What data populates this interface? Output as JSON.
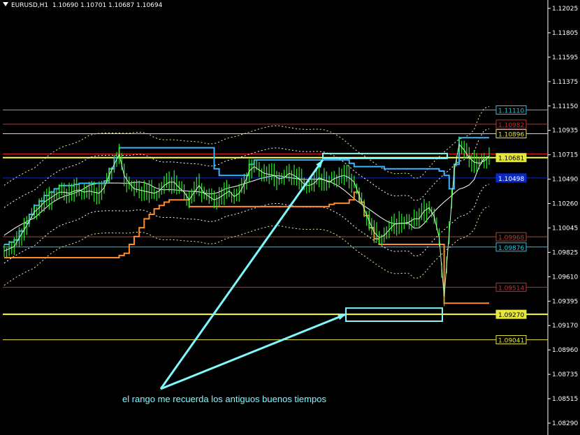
{
  "header": {
    "symbol": "EURUSD,H1",
    "open": "1.10690",
    "high": "1.10701",
    "low": "1.10687",
    "close": "1.10694"
  },
  "caption": "el rango me recuerda los antiguos buenos tiempos",
  "chart_data": {
    "type": "line",
    "symbol": "EURUSD",
    "timeframe": "H1",
    "ylim": [
      1.0841,
      1.1232
    ],
    "y_ticks": [
      "1.12025",
      "1.11805",
      "1.11595",
      "1.11375",
      "1.11150",
      "1.10935",
      "1.10715",
      "1.10490",
      "1.10260",
      "1.10045",
      "1.09825",
      "1.09610",
      "1.09395",
      "1.09170",
      "1.08960",
      "1.08735",
      "1.08515",
      "1.08290"
    ],
    "axis_labels": [
      {
        "value": "1.11110",
        "price": 1.1111,
        "bg": "#000000",
        "border": "#1ec8e6",
        "text": "#1ec8e6"
      },
      {
        "value": "1.10982",
        "price": 1.10982,
        "bg": "#000000",
        "border": "#c03030",
        "text": "#c03030"
      },
      {
        "value": "1.10896",
        "price": 1.10896,
        "bg": "#000000",
        "border": "#e6e640",
        "text": "#e6e640"
      },
      {
        "value": "1.10681",
        "price": 1.10681,
        "bg": "#e6e640",
        "border": "#e6e640",
        "text": "#000000"
      },
      {
        "value": "1.10498",
        "price": 1.10498,
        "bg": "#0a28c8",
        "border": "#0a28c8",
        "text": "#ffffff"
      },
      {
        "value": "1.09968",
        "price": 1.09968,
        "bg": "#000000",
        "border": "#a84a38",
        "text": "#a84a38"
      },
      {
        "value": "1.09876",
        "price": 1.09876,
        "bg": "#000000",
        "border": "#1ec8e6",
        "text": "#1ec8e6"
      },
      {
        "value": "1.09514",
        "price": 1.09514,
        "bg": "#000000",
        "border": "#c03030",
        "text": "#c03030"
      },
      {
        "value": "1.09270",
        "price": 1.0927,
        "bg": "#e6e640",
        "border": "#e6e640",
        "text": "#000000"
      },
      {
        "value": "1.09041",
        "price": 1.09041,
        "bg": "#000000",
        "border": "#e6e640",
        "text": "#e6e640"
      }
    ],
    "hlines": [
      {
        "price": 1.1111,
        "color": "#1ec8e6",
        "width": 1
      },
      {
        "price": 1.10982,
        "color": "#c03030",
        "width": 1
      },
      {
        "price": 1.10896,
        "color": "#e6e640",
        "width": 1
      },
      {
        "price": 1.10715,
        "color": "#ff2020",
        "width": 1
      },
      {
        "price": 1.10681,
        "color": "#ffff40",
        "width": 2
      },
      {
        "price": 1.10498,
        "color": "#0a28c8",
        "width": 1
      },
      {
        "price": 1.09968,
        "color": "#a84a38",
        "width": 1
      },
      {
        "price": 1.09876,
        "color": "#1ec8e6",
        "width": 1
      },
      {
        "price": 1.09514,
        "color": "#c03030",
        "width": 1
      },
      {
        "price": 1.0927,
        "color": "#ffff40",
        "width": 2
      },
      {
        "price": 1.09041,
        "color": "#e6e640",
        "width": 1
      }
    ],
    "price_series": [
      1.0984,
      1.0986,
      1.0988,
      1.0996,
      1.1003,
      1.1011,
      1.1019,
      1.1023,
      1.1028,
      1.1031,
      1.1034,
      1.1037,
      1.1037,
      1.1036,
      1.1038,
      1.1039,
      1.1037,
      1.1038,
      1.1037,
      1.1036,
      1.1041,
      1.1052,
      1.1062,
      1.1071,
      1.1052,
      1.1045,
      1.104,
      1.1039,
      1.1038,
      1.1037,
      1.1036,
      1.1038,
      1.1043,
      1.1046,
      1.1046,
      1.1041,
      1.1037,
      1.103,
      1.1037,
      1.1043,
      1.1036,
      1.1033,
      1.103,
      1.1032,
      1.1035,
      1.1038,
      1.1033,
      1.1036,
      1.1044,
      1.1056,
      1.106,
      1.1057,
      1.1054,
      1.1053,
      1.1052,
      1.1049,
      1.105,
      1.1054,
      1.1052,
      1.1049,
      1.1044,
      1.1043,
      1.1045,
      1.105,
      1.1048,
      1.1046,
      1.1049,
      1.1051,
      1.1052,
      1.105,
      1.1046,
      1.1034,
      1.1022,
      1.1011,
      1.1001,
      1.0996,
      1.0998,
      1.1003,
      1.1008,
      1.1009,
      1.1009,
      1.101,
      1.1013,
      1.1013,
      1.102,
      1.1023,
      1.1015,
      1.0996,
      1.0943,
      1.1,
      1.1056,
      1.108,
      1.1075,
      1.1068,
      1.1064,
      1.1063,
      1.1065,
      1.1069
    ],
    "dotted_pairs_note": "",
    "annotations": [
      {
        "type": "rectangle",
        "price_top": 1.10718,
        "price_bottom": 1.10674,
        "color": "#7ff8ff"
      },
      {
        "type": "rectangle",
        "price_top": 1.09326,
        "price_bottom": 1.09208,
        "color": "#7ff8ff"
      },
      {
        "type": "text",
        "text_ref": "caption",
        "color": "#7ff8ff"
      }
    ]
  }
}
